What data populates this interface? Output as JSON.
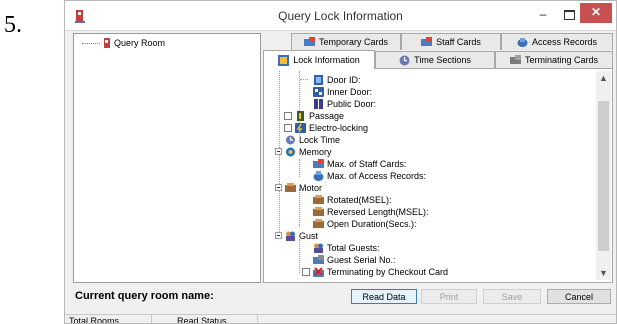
{
  "step_number": "5.",
  "window": {
    "title": "Query Lock Information",
    "minimize": "–",
    "close": "✕"
  },
  "room_tree": {
    "root": "Query Room"
  },
  "tabs": [
    {
      "label": "Temporary Cards",
      "icon": "card-icon",
      "active": false
    },
    {
      "label": "Staff Cards",
      "icon": "card-icon",
      "active": false
    },
    {
      "label": "Access Records",
      "icon": "records-icon",
      "active": false
    },
    {
      "label": "Lock Information",
      "icon": "lock-icon",
      "active": true
    },
    {
      "label": "Time Sections",
      "icon": "clock-icon",
      "active": false
    },
    {
      "label": "Terminating Cards",
      "icon": "card-icon",
      "active": false
    }
  ],
  "lock_tree": [
    {
      "label": "Door ID:",
      "icon": "door-icon",
      "check": false
    },
    {
      "label": "Inner Door:",
      "icon": "door-icon",
      "check": false
    },
    {
      "label": "Public Door:",
      "icon": "door-icon",
      "check": false
    },
    {
      "label": "Passage",
      "icon": "passage-icon",
      "check": true
    },
    {
      "label": "Electro-locking",
      "icon": "electro-icon",
      "check": true
    },
    {
      "label": "Lock Time",
      "icon": "clock-icon",
      "check": false
    },
    {
      "label": "Memory",
      "icon": "memory-icon",
      "check": false,
      "expander": true
    },
    {
      "label": "Max. of Staff Cards:",
      "icon": "card-icon",
      "check": false
    },
    {
      "label": "Max. of Access Records:",
      "icon": "records-icon",
      "check": false
    },
    {
      "label": "Motor",
      "icon": "motor-icon",
      "check": false,
      "expander": true
    },
    {
      "label": "Rotated(MSEL):",
      "icon": "motor-icon",
      "check": false
    },
    {
      "label": "Reversed Length(MSEL):",
      "icon": "motor-icon",
      "check": false
    },
    {
      "label": "Open Duration(Secs.):",
      "icon": "motor-icon",
      "check": false
    },
    {
      "label": "Gust",
      "icon": "guest-icon",
      "check": false,
      "expander": true
    },
    {
      "label": "Total Guests:",
      "icon": "guest-icon",
      "check": false
    },
    {
      "label": "Guest Serial No.:",
      "icon": "card-icon",
      "check": false
    },
    {
      "label": "Terminating by Checkout Card",
      "icon": "terminate-icon",
      "check": true
    }
  ],
  "footer": {
    "current_room_label": "Current query room name:"
  },
  "buttons": {
    "read": "Read Data",
    "print": "Print",
    "save": "Save",
    "cancel": "Cancel"
  },
  "status_bar": {
    "total_rooms": "Total Rooms",
    "read_status": "Read Status"
  },
  "colors": {
    "close": "#c75050",
    "accent": "#3c7fb1"
  }
}
